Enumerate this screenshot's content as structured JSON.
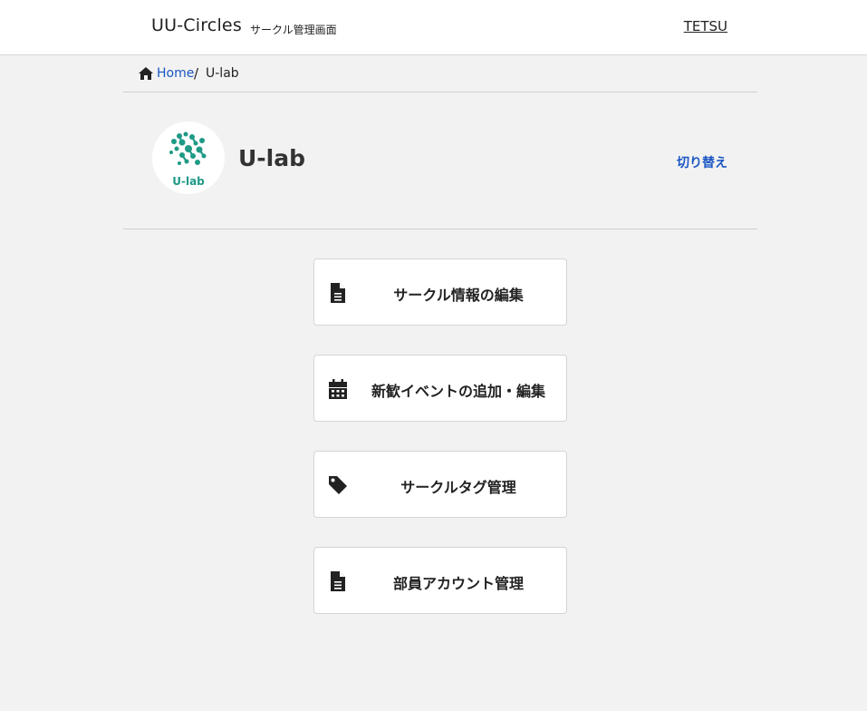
{
  "header": {
    "brand": "UU-Circles",
    "subtitle": "サークル管理画面",
    "user": "TETSU"
  },
  "breadcrumb": {
    "home_icon": "home-icon",
    "home": "Home",
    "separator": "/",
    "current": "U-lab"
  },
  "circle": {
    "name": "U-lab",
    "logo_text": "U-lab",
    "switch_label": "切り替え"
  },
  "menu": [
    {
      "icon": "document-icon",
      "label": "サークル情報の編集"
    },
    {
      "icon": "calendar-icon",
      "label": "新歓イベントの追加・編集"
    },
    {
      "icon": "tag-icon",
      "label": "サークルタグ管理"
    },
    {
      "icon": "document-icon",
      "label": "部員アカウント管理"
    }
  ],
  "colors": {
    "background": "#f2f2f2",
    "link": "#1a56c4",
    "logo_teal": "#1f9a86"
  }
}
